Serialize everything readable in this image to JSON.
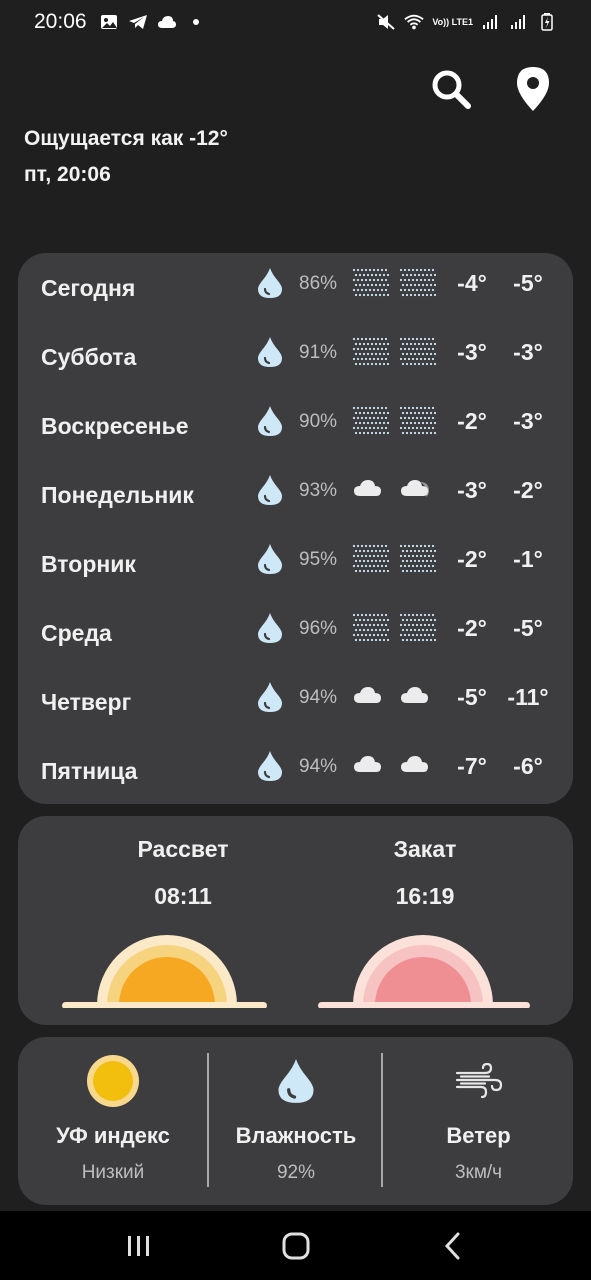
{
  "status": {
    "time": "20:06",
    "network": "Vo)) LTE1"
  },
  "header": {
    "feels_like": "Ощущается как -12°",
    "datetime": "пт, 20:06"
  },
  "forecast": [
    {
      "day": "Сегодня",
      "humidity": "86%",
      "icon1": "snow-icon",
      "icon2": "snow-icon",
      "t1": "-4°",
      "t2": "-5°"
    },
    {
      "day": "Суббота",
      "humidity": "91%",
      "icon1": "snow-icon",
      "icon2": "snow-icon",
      "t1": "-3°",
      "t2": "-3°"
    },
    {
      "day": "Воскресенье",
      "humidity": "90%",
      "icon1": "snow-icon",
      "icon2": "snow-icon",
      "t1": "-2°",
      "t2": "-3°"
    },
    {
      "day": "Понедельник",
      "humidity": "93%",
      "icon1": "cloud-icon",
      "icon2": "cloud-moon-icon",
      "t1": "-3°",
      "t2": "-2°"
    },
    {
      "day": "Вторник",
      "humidity": "95%",
      "icon1": "snow-icon",
      "icon2": "snow-icon",
      "t1": "-2°",
      "t2": "-1°"
    },
    {
      "day": "Среда",
      "humidity": "96%",
      "icon1": "snow-icon",
      "icon2": "snow-icon",
      "t1": "-2°",
      "t2": "-5°"
    },
    {
      "day": "Четверг",
      "humidity": "94%",
      "icon1": "cloud-icon",
      "icon2": "cloud-icon",
      "t1": "-5°",
      "t2": "-11°"
    },
    {
      "day": "Пятница",
      "humidity": "94%",
      "icon1": "cloud-icon",
      "icon2": "cloud-icon",
      "t1": "-7°",
      "t2": "-6°"
    }
  ],
  "sun": {
    "sunrise_label": "Рассвет",
    "sunrise_time": "08:11",
    "sunset_label": "Закат",
    "sunset_time": "16:19"
  },
  "info": {
    "uv_title": "УФ индекс",
    "uv_value": "Низкий",
    "humidity_title": "Влажность",
    "humidity_value": "92%",
    "wind_title": "Ветер",
    "wind_value": "3км/ч"
  },
  "colors": {
    "background": "#1f1f20",
    "card": "#3d3d3f",
    "drop": "#cfe8f8",
    "sunrise": "#f5a623",
    "sunset": "#ef8f94",
    "uv": "#f2bf0f"
  }
}
